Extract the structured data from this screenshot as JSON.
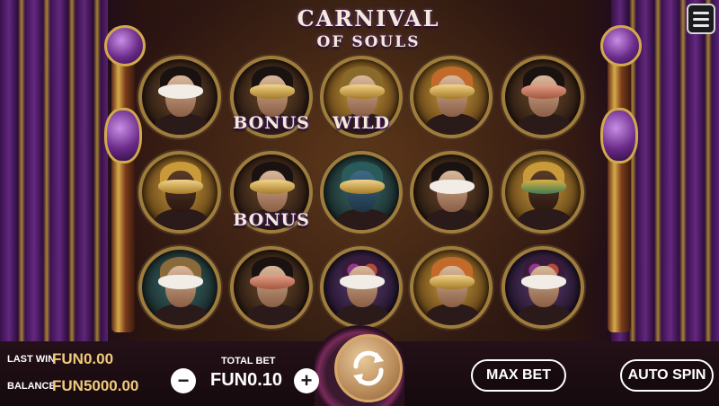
{
  "title": {
    "line1": "CARNIVAL",
    "line2": "OF SOULS"
  },
  "menu": {
    "icon": "hamburger-menu-icon"
  },
  "reels": {
    "labels": {
      "bonus_1": "BONUS",
      "wild": "WILD",
      "bonus_2": "BONUS"
    }
  },
  "controls": {
    "last_win_label": "LAST WIN",
    "last_win_value": "FUN0.00",
    "balance_label": "BALANCE",
    "balance_value": "FUN5000.00",
    "total_bet_label": "TOTAL BET",
    "total_bet_value": "FUN0.10",
    "minus_symbol": "−",
    "plus_symbol": "+",
    "max_bet_label": "MAX BET",
    "auto_spin_label": "AUTO SPIN"
  },
  "colors": {
    "accent_gold": "#f0c97a",
    "purple": "#6a2b88"
  }
}
